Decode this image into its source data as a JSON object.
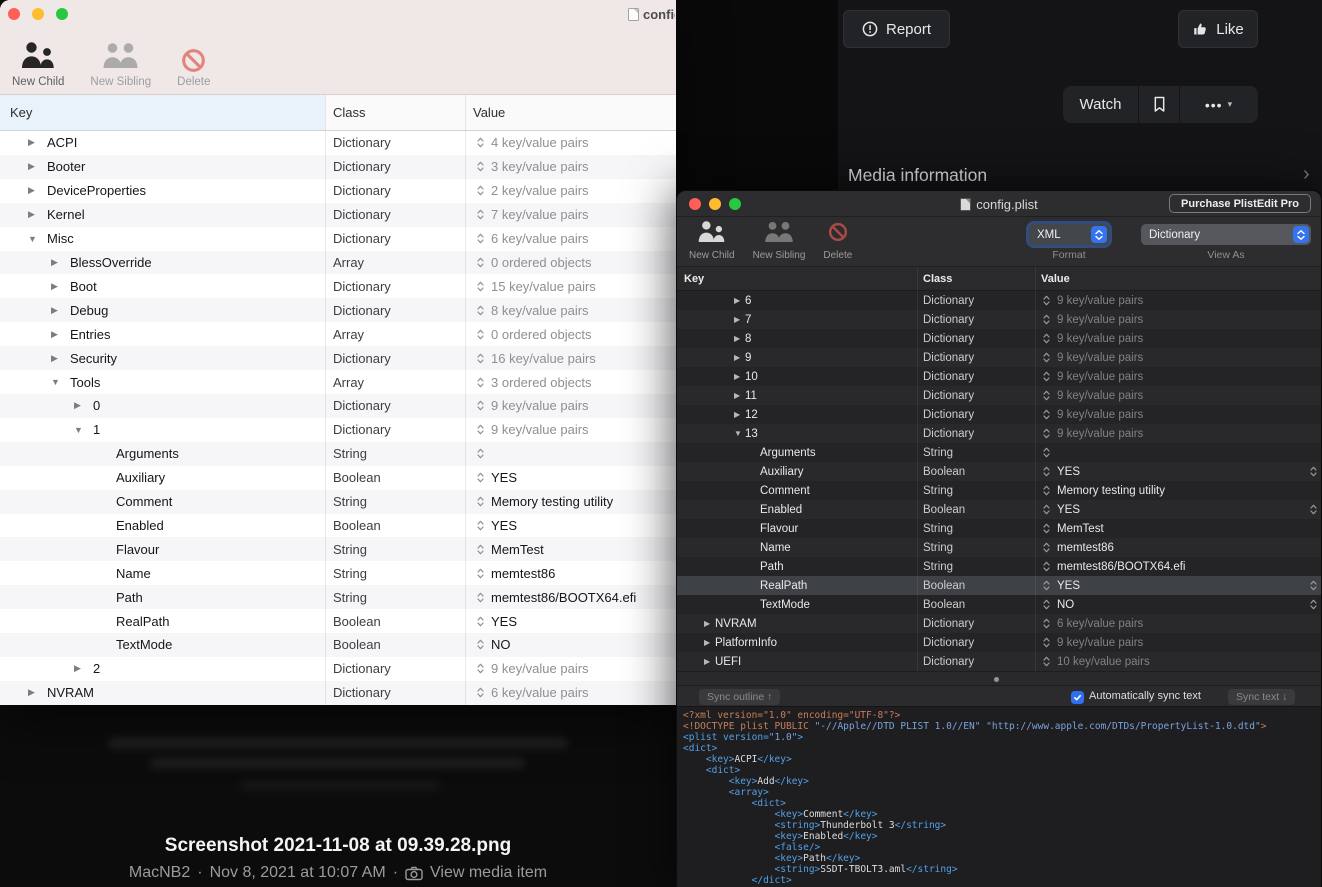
{
  "forum": {
    "report_button_label": "Report",
    "like_button_label": "Like",
    "watch_button_label": "Watch",
    "more_button_label": "•••",
    "media_information_heading": "Media information",
    "media_title": "Screenshot 2021-11-08 at 09.39.28.png",
    "media_meta": {
      "author": "MacNB2",
      "separator": "·",
      "timestamp": "Nov 8, 2021 at 10:07 AM",
      "view_media_label": "View media item"
    }
  },
  "left_window": {
    "title": "config.plist",
    "toolbar": {
      "new_child_label": "New Child",
      "new_sibling_label": "New Sibling",
      "delete_label": "Delete"
    },
    "columns": {
      "key": "Key",
      "class": "Class",
      "value": "Value"
    },
    "rows": [
      {
        "key": "ACPI",
        "level": 0,
        "disc": "collapsed",
        "cls": "Dictionary",
        "val": "4 key/value pairs",
        "kind": "summary"
      },
      {
        "key": "Booter",
        "level": 0,
        "disc": "collapsed",
        "cls": "Dictionary",
        "val": "3 key/value pairs",
        "kind": "summary"
      },
      {
        "key": "DeviceProperties",
        "level": 0,
        "disc": "collapsed",
        "cls": "Dictionary",
        "val": "2 key/value pairs",
        "kind": "summary"
      },
      {
        "key": "Kernel",
        "level": 0,
        "disc": "collapsed",
        "cls": "Dictionary",
        "val": "7 key/value pairs",
        "kind": "summary"
      },
      {
        "key": "Misc",
        "level": 0,
        "disc": "expanded",
        "cls": "Dictionary",
        "val": "6 key/value pairs",
        "kind": "summary"
      },
      {
        "key": "BlessOverride",
        "level": 1,
        "disc": "collapsed",
        "cls": "Array",
        "val": "0 ordered objects",
        "kind": "summary"
      },
      {
        "key": "Boot",
        "level": 1,
        "disc": "collapsed",
        "cls": "Dictionary",
        "val": "15 key/value pairs",
        "kind": "summary"
      },
      {
        "key": "Debug",
        "level": 1,
        "disc": "collapsed",
        "cls": "Dictionary",
        "val": "8 key/value pairs",
        "kind": "summary"
      },
      {
        "key": "Entries",
        "level": 1,
        "disc": "collapsed",
        "cls": "Array",
        "val": "0 ordered objects",
        "kind": "summary"
      },
      {
        "key": "Security",
        "level": 1,
        "disc": "collapsed",
        "cls": "Dictionary",
        "val": "16 key/value pairs",
        "kind": "summary"
      },
      {
        "key": "Tools",
        "level": 1,
        "disc": "expanded",
        "cls": "Array",
        "val": "3 ordered objects",
        "kind": "summary"
      },
      {
        "key": "0",
        "level": 2,
        "disc": "collapsed",
        "cls": "Dictionary",
        "val": "9 key/value pairs",
        "kind": "summary"
      },
      {
        "key": "1",
        "level": 2,
        "disc": "expanded",
        "cls": "Dictionary",
        "val": "9 key/value pairs",
        "kind": "summary"
      },
      {
        "key": "Arguments",
        "level": 3,
        "disc": "none",
        "cls": "String",
        "val": "",
        "kind": "value"
      },
      {
        "key": "Auxiliary",
        "level": 3,
        "disc": "none",
        "cls": "Boolean",
        "val": "YES",
        "kind": "value"
      },
      {
        "key": "Comment",
        "level": 3,
        "disc": "none",
        "cls": "String",
        "val": "Memory testing utility",
        "kind": "value"
      },
      {
        "key": "Enabled",
        "level": 3,
        "disc": "none",
        "cls": "Boolean",
        "val": "YES",
        "kind": "value"
      },
      {
        "key": "Flavour",
        "level": 3,
        "disc": "none",
        "cls": "String",
        "val": "MemTest",
        "kind": "value"
      },
      {
        "key": "Name",
        "level": 3,
        "disc": "none",
        "cls": "String",
        "val": "memtest86",
        "kind": "value"
      },
      {
        "key": "Path",
        "level": 3,
        "disc": "none",
        "cls": "String",
        "val": "memtest86/BOOTX64.efi",
        "kind": "value"
      },
      {
        "key": "RealPath",
        "level": 3,
        "disc": "none",
        "cls": "Boolean",
        "val": "YES",
        "kind": "value"
      },
      {
        "key": "TextMode",
        "level": 3,
        "disc": "none",
        "cls": "Boolean",
        "val": "NO",
        "kind": "value"
      },
      {
        "key": "2",
        "level": 2,
        "disc": "collapsed",
        "cls": "Dictionary",
        "val": "9 key/value pairs",
        "kind": "summary"
      },
      {
        "key": "NVRAM",
        "level": 0,
        "disc": "collapsed",
        "cls": "Dictionary",
        "val": "6 key/value pairs",
        "kind": "summary"
      }
    ]
  },
  "right_window": {
    "title": "config.plist",
    "purchase_button_label": "Purchase PlistEdit Pro",
    "toolbar": {
      "new_child_label": "New Child",
      "new_sibling_label": "New Sibling",
      "delete_label": "Delete"
    },
    "format_popup": {
      "value": "XML",
      "label": "Format"
    },
    "view_as_popup": {
      "value": "Dictionary",
      "label": "View As"
    },
    "columns": {
      "key": "Key",
      "class": "Class",
      "value": "Value"
    },
    "rows": [
      {
        "key": "6",
        "level": 2,
        "disc": "collapsed",
        "cls": "Dictionary",
        "val": "9 key/value pairs",
        "kind": "summary"
      },
      {
        "key": "7",
        "level": 2,
        "disc": "collapsed",
        "cls": "Dictionary",
        "val": "9 key/value pairs",
        "kind": "summary"
      },
      {
        "key": "8",
        "level": 2,
        "disc": "collapsed",
        "cls": "Dictionary",
        "val": "9 key/value pairs",
        "kind": "summary"
      },
      {
        "key": "9",
        "level": 2,
        "disc": "collapsed",
        "cls": "Dictionary",
        "val": "9 key/value pairs",
        "kind": "summary"
      },
      {
        "key": "10",
        "level": 2,
        "disc": "collapsed",
        "cls": "Dictionary",
        "val": "9 key/value pairs",
        "kind": "summary"
      },
      {
        "key": "11",
        "level": 2,
        "disc": "collapsed",
        "cls": "Dictionary",
        "val": "9 key/value pairs",
        "kind": "summary"
      },
      {
        "key": "12",
        "level": 2,
        "disc": "collapsed",
        "cls": "Dictionary",
        "val": "9 key/value pairs",
        "kind": "summary"
      },
      {
        "key": "13",
        "level": 2,
        "disc": "expanded",
        "cls": "Dictionary",
        "val": "9 key/value pairs",
        "kind": "summary"
      },
      {
        "key": "Arguments",
        "level": 3,
        "disc": "none",
        "cls": "String",
        "val": "",
        "kind": "value"
      },
      {
        "key": "Auxiliary",
        "level": 3,
        "disc": "none",
        "cls": "Boolean",
        "val": "YES",
        "kind": "value",
        "rstep": true
      },
      {
        "key": "Comment",
        "level": 3,
        "disc": "none",
        "cls": "String",
        "val": "Memory testing utility",
        "kind": "value"
      },
      {
        "key": "Enabled",
        "level": 3,
        "disc": "none",
        "cls": "Boolean",
        "val": "YES",
        "kind": "value",
        "rstep": true
      },
      {
        "key": "Flavour",
        "level": 3,
        "disc": "none",
        "cls": "String",
        "val": "MemTest",
        "kind": "value"
      },
      {
        "key": "Name",
        "level": 3,
        "disc": "none",
        "cls": "String",
        "val": "memtest86",
        "kind": "value"
      },
      {
        "key": "Path",
        "level": 3,
        "disc": "none",
        "cls": "String",
        "val": "memtest86/BOOTX64.efi",
        "kind": "value"
      },
      {
        "key": "RealPath",
        "level": 3,
        "disc": "none",
        "cls": "Boolean",
        "val": "YES",
        "kind": "value",
        "rstep": true,
        "selected": true
      },
      {
        "key": "TextMode",
        "level": 3,
        "disc": "none",
        "cls": "Boolean",
        "val": "NO",
        "kind": "value",
        "rstep": true
      },
      {
        "key": "NVRAM",
        "level": 0,
        "disc": "collapsed",
        "cls": "Dictionary",
        "val": "6 key/value pairs",
        "kind": "summary"
      },
      {
        "key": "PlatformInfo",
        "level": 0,
        "disc": "collapsed",
        "cls": "Dictionary",
        "val": "9 key/value pairs",
        "kind": "summary"
      },
      {
        "key": "UEFI",
        "level": 0,
        "disc": "collapsed",
        "cls": "Dictionary",
        "val": "10 key/value pairs",
        "kind": "summary"
      }
    ],
    "sync_bar": {
      "sync_outline_label": "Sync outline ↑",
      "checkbox_label": "Automatically sync text",
      "checkbox_checked": true,
      "sync_text_label": "Sync text ↓"
    },
    "xml_lines": [
      [
        [
          "m",
          "<?xml version=\"1.0\" encoding=\"UTF-8\"?>"
        ]
      ],
      [
        [
          "m",
          "<!DOCTYPE plist PUBLIC "
        ],
        [
          "q",
          "\"-//Apple//DTD PLIST 1.0//EN\""
        ],
        [
          "m",
          " "
        ],
        [
          "q",
          "\"http://www.apple.com/DTDs/PropertyList-1.0.dtd\""
        ],
        [
          "m",
          ">"
        ]
      ],
      [
        [
          "t",
          "<plist version="
        ],
        [
          "q",
          "\"1.0\""
        ],
        [
          "t",
          ">"
        ]
      ],
      [
        [
          "t",
          "<dict>"
        ]
      ],
      [
        [
          "w",
          "    "
        ],
        [
          "t",
          "<key>"
        ],
        [
          "s",
          "ACPI"
        ],
        [
          "t",
          "</key>"
        ]
      ],
      [
        [
          "w",
          "    "
        ],
        [
          "t",
          "<dict>"
        ]
      ],
      [
        [
          "w",
          "        "
        ],
        [
          "t",
          "<key>"
        ],
        [
          "s",
          "Add"
        ],
        [
          "t",
          "</key>"
        ]
      ],
      [
        [
          "w",
          "        "
        ],
        [
          "t",
          "<array>"
        ]
      ],
      [
        [
          "w",
          "            "
        ],
        [
          "t",
          "<dict>"
        ]
      ],
      [
        [
          "w",
          "                "
        ],
        [
          "t",
          "<key>"
        ],
        [
          "s",
          "Comment"
        ],
        [
          "t",
          "</key>"
        ]
      ],
      [
        [
          "w",
          "                "
        ],
        [
          "t",
          "<string>"
        ],
        [
          "s",
          "Thunderbolt 3"
        ],
        [
          "t",
          "</string>"
        ]
      ],
      [
        [
          "w",
          "                "
        ],
        [
          "t",
          "<key>"
        ],
        [
          "s",
          "Enabled"
        ],
        [
          "t",
          "</key>"
        ]
      ],
      [
        [
          "w",
          "                "
        ],
        [
          "t",
          "<false/>"
        ]
      ],
      [
        [
          "w",
          "                "
        ],
        [
          "t",
          "<key>"
        ],
        [
          "s",
          "Path"
        ],
        [
          "t",
          "</key>"
        ]
      ],
      [
        [
          "w",
          "                "
        ],
        [
          "t",
          "<string>"
        ],
        [
          "s",
          "SSDT-TBOLT3.aml"
        ],
        [
          "t",
          "</string>"
        ]
      ],
      [
        [
          "w",
          "            "
        ],
        [
          "t",
          "</dict>"
        ]
      ]
    ]
  },
  "colors": {
    "accent_blue": "#3574F0",
    "traffic_red": "#FF5F57",
    "traffic_yellow": "#FEBC2E",
    "traffic_green": "#28C840",
    "delete_red": "#D0433C",
    "xml_tag": "#54A0E4",
    "xml_meta": "#C87D5A"
  }
}
